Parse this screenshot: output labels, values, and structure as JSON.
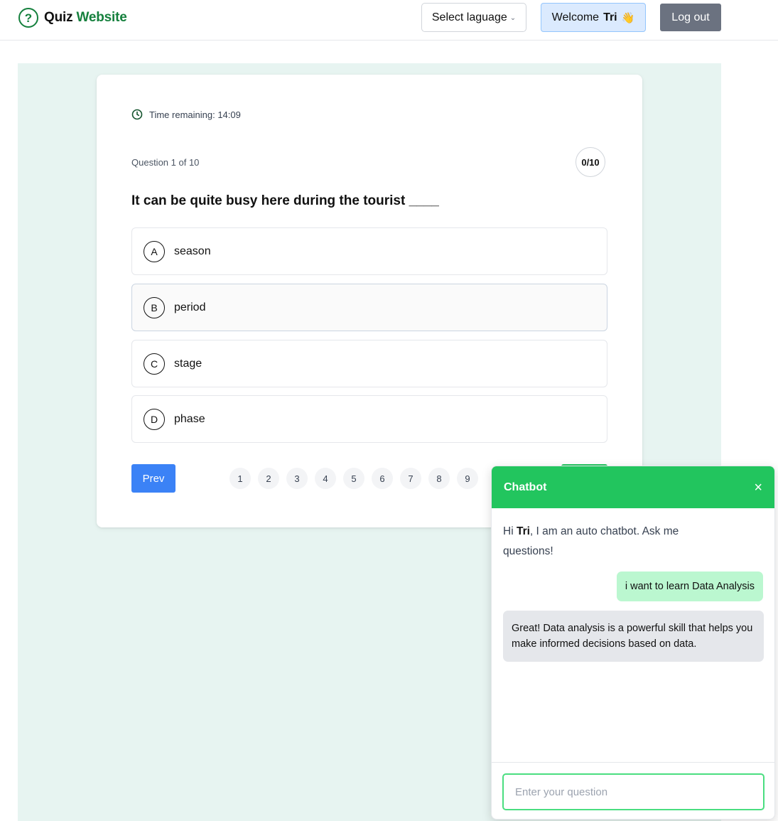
{
  "header": {
    "brand_icon": "?",
    "brand_first": "Quiz",
    "brand_second": "Website",
    "language_select": "Select laguage",
    "welcome_prefix": "Welcome",
    "welcome_user": "Tri",
    "wave_emoji": "👋",
    "logout_label": "Log out"
  },
  "quiz": {
    "timer_label": "Time remaining: 14:09",
    "question_count": "Question 1 of 10",
    "score": "0/10",
    "question_text": "It can be quite busy here during the tourist ____",
    "options": [
      {
        "letter": "A",
        "text": "season"
      },
      {
        "letter": "B",
        "text": "period"
      },
      {
        "letter": "C",
        "text": "stage"
      },
      {
        "letter": "D",
        "text": "phase"
      }
    ],
    "prev_label": "Prev",
    "pages": [
      "1",
      "2",
      "3",
      "4",
      "5",
      "6",
      "7",
      "8",
      "9"
    ]
  },
  "chatbot": {
    "title": "Chatbot",
    "close_icon": "×",
    "greet_prefix": "Hi ",
    "greet_user": "Tri",
    "greet_suffix": ", I am an auto chatbot. Ask me questions!",
    "messages": [
      {
        "from": "user",
        "text": "i want to learn Data Analysis"
      },
      {
        "from": "bot",
        "text": "Great! Data analysis is a powerful skill that helps you make informed decisions based on data."
      }
    ],
    "input_placeholder": "Enter your question"
  },
  "colors": {
    "brand_green": "#15803d",
    "chat_green": "#22c55e",
    "prev_blue": "#3b82f6",
    "page_bg": "#e7f4f1"
  }
}
